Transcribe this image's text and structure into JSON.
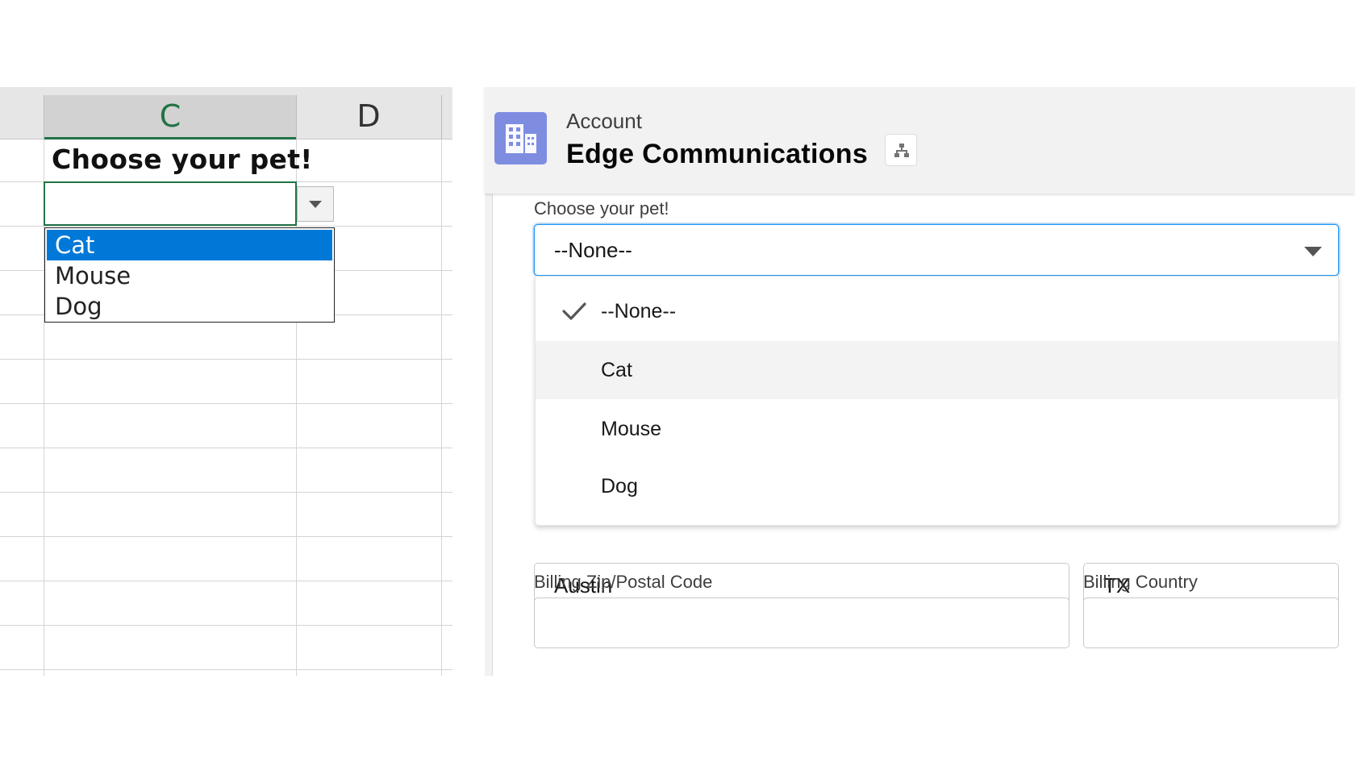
{
  "excel": {
    "columns": [
      "C",
      "D"
    ],
    "heading_cell": "Choose your pet!",
    "active_cell_value": "",
    "dropdown_options": [
      "Cat",
      "Mouse",
      "Dog"
    ],
    "highlighted_option": "Cat",
    "colors": {
      "accent": "#217346",
      "selection": "#0078d7"
    }
  },
  "salesforce": {
    "object_type": "Account",
    "record_name": "Edge Communications",
    "hierarchy_icon": "hierarchy-icon",
    "object_icon": "account-icon",
    "field_label": "Choose your pet!",
    "field_value": "--None--",
    "options": [
      {
        "label": "--None--",
        "checked": true
      },
      {
        "label": "Cat",
        "hovered": true
      },
      {
        "label": "Mouse"
      },
      {
        "label": "Dog"
      }
    ],
    "billing_city": "Austin",
    "billing_state": "TX",
    "billing_zip_label": "Billing Zip/Postal Code",
    "billing_zip_value": "",
    "billing_country_label": "Billing Country",
    "billing_country_value": "",
    "colors": {
      "icon_bg": "#7f8de1",
      "focus_border": "#1b96ff"
    }
  }
}
